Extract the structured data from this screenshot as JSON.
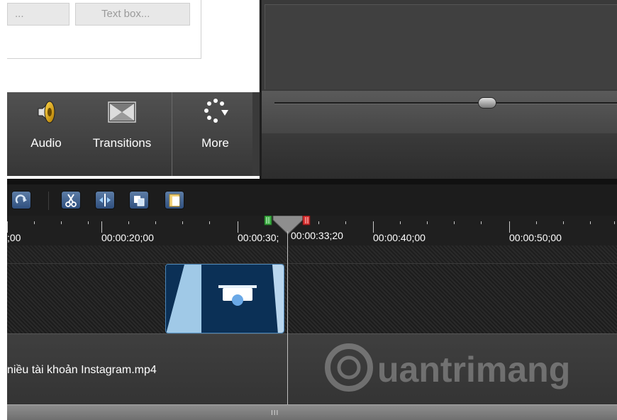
{
  "props": {
    "textbox_a": "...",
    "textbox_b": "Text box..."
  },
  "tabs": {
    "audio": "Audio",
    "transitions": "Transitions",
    "more": "More"
  },
  "toolbar": {
    "buttons": [
      "redo-icon",
      "cut-icon",
      "split-icon",
      "copy-icon",
      "paste-icon"
    ]
  },
  "ruler": {
    "labels": [
      ";00",
      "00:00:20;00",
      "00:00:30;",
      "00:00:33;20",
      "00:00:40;00",
      "00:00:50;00"
    ]
  },
  "media": {
    "clip_label": "niều tài khoản Instagram.mp4"
  },
  "watermark": {
    "text": "uantrimang"
  },
  "playhead": {
    "time": "00:00:33;20"
  },
  "bottom": {
    "grip": "III"
  },
  "colors": {
    "in_marker": "#3cb043",
    "out_marker": "#d93030",
    "clip_border": "#4b86b8",
    "toolbar_button": "#3f6393"
  }
}
